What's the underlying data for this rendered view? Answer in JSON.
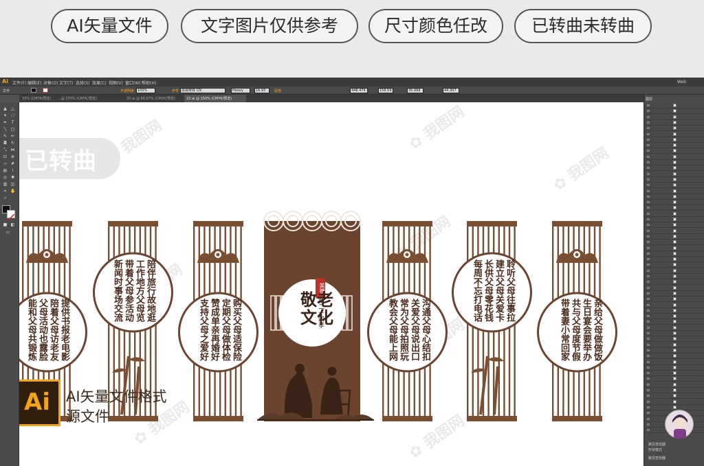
{
  "tags": [
    "AI矢量文件",
    "文字图片仅供参考",
    "尺寸颜色任改",
    "已转曲未转曲"
  ],
  "app": {
    "logo": "Ai",
    "menu": [
      "文件(F)",
      "编辑(E)",
      "对象(O)",
      "文字(T)",
      "选择(S)",
      "效果(C)",
      "视图(V)",
      "窗口(W)",
      "帮助(H)"
    ],
    "workspace": "Web",
    "control": {
      "label": "文字",
      "opacity_label": "不透明度",
      "opacity_value": "100%",
      "char_label": "字符",
      "font": "思源宋体 CN",
      "style": "Heavy",
      "size": "16.93",
      "para_label": "段落",
      "x": "448.474",
      "y": "158.59",
      "w": "35.998",
      "h": "44.307"
    },
    "tabs": [
      "33% (CMYK/预览)",
      "...@ 150% (CMYK/预览)",
      "20.ai @ 66.67% (CMYK/预览)",
      "22.ai @ 150% (CMYK/预览)"
    ],
    "panel_title": "图层",
    "panel_bottom": [
      "路径查找器",
      "形状模式",
      "路径查找器"
    ]
  },
  "canvas": {
    "converted_label": "已转曲",
    "center": {
      "stamp": "美德",
      "title": "敬老文化",
      "subtitle": "新二十四孝"
    },
    "panels": [
      {
        "lines": [
          "提供书报老电影",
          "陪着父母访老友",
          "父母活动也露脸",
          "能和父母共锻炼"
        ]
      },
      {
        "lines": [
          "陪伴旅行故地逛",
          "工作地方父母览",
          "带着父母参活动",
          "新闻时事场交流"
        ]
      },
      {
        "lines": [
          "购买父母适保险",
          "定期父母做体检",
          "赞成单亲再婚好",
          "支持父母之爱好"
        ]
      },
      {
        "lines": [
          "沟通父母心结扣",
          "关爱父母说出口",
          "常为父母拍照玩",
          "教会父母能上网"
        ]
      },
      {
        "lines": [
          "聆听父母往事拉",
          "建立父母关爱卡",
          "长供父母零花钱",
          "每周不忘打电话"
        ]
      },
      {
        "lines": [
          "亲给父母做做饭",
          "生日宴会要举办",
          "共与父母度节假",
          "带着妻小常回家"
        ]
      }
    ],
    "ai_badge": "Ai",
    "ai_caption_1": "AI矢量文件格式",
    "ai_caption_2": "源文件"
  },
  "colors": {
    "brown": "#7a4e33",
    "dark_brown": "#6b4430",
    "ai_orange": "#f3a21a"
  }
}
